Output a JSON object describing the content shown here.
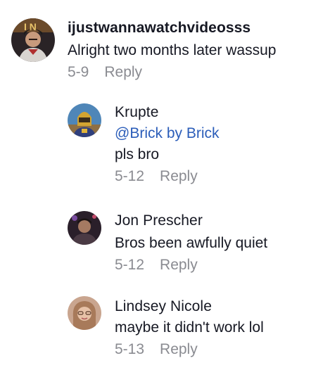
{
  "comments": [
    {
      "username": "ijustwannawatchvideosss",
      "text": "Alright two months later wassup",
      "date": "5-9",
      "reply_label": "Reply"
    }
  ],
  "replies": [
    {
      "username": "Krupte",
      "mention": "@Brick by Brick",
      "text": "pls bro",
      "date": "5-12",
      "reply_label": "Reply"
    },
    {
      "username": "Jon Prescher",
      "text": "Bros been awfully quiet",
      "date": "5-12",
      "reply_label": "Reply"
    },
    {
      "username": "Lindsey Nicole",
      "text": "maybe it didn't work lol",
      "date": "5-13",
      "reply_label": "Reply"
    }
  ],
  "colors": {
    "username": "#161823",
    "meta_gray": "#8a8b91",
    "mention_blue": "#2b5db9"
  }
}
